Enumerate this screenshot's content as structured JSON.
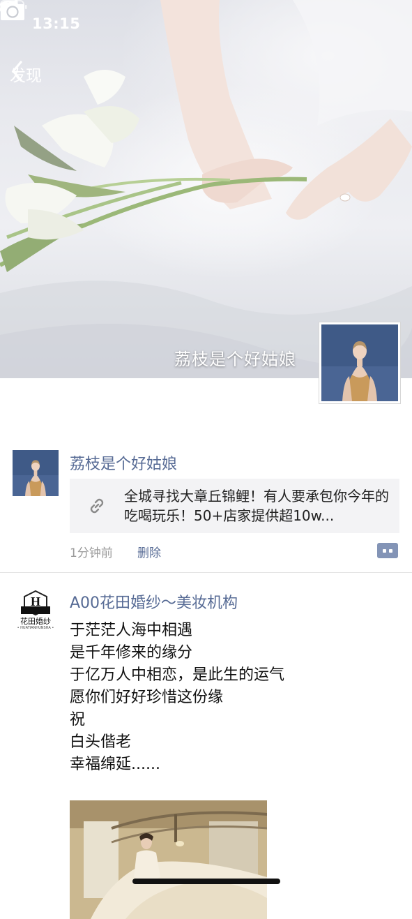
{
  "status_bar": {
    "time": "13:15"
  },
  "nav": {
    "back_label": "发现"
  },
  "cover": {
    "username": "荔枝是个好姑娘"
  },
  "posts": [
    {
      "author": "荔枝是个好姑娘",
      "link_title": "全城寻找大章丘锦鲤！有人要承包你今年的吃喝玩乐！50+店家提供超10w...",
      "time": "1分钟前",
      "delete_label": "删除"
    },
    {
      "author": "A00花田婚纱～美妆机构",
      "logo_text": "花田婚纱",
      "logo_subtext": "• HUATIANHUNSHA •",
      "logo_letter": "H",
      "text": "于茫茫人海中相遇\n是千年修来的缘分\n于亿万人中相恋，是此生的运气\n愿你们好好珍惜这份缘\n祝\n白头偕老\n幸福绵延......"
    }
  ],
  "colors": {
    "link_blue": "#576b95",
    "meta_gray": "#9a9a9a",
    "card_bg": "#f3f3f5",
    "comment_button": "#8394b6"
  },
  "icons": [
    "signal-icon",
    "wifi-icon",
    "battery-icon",
    "back-chevron-icon",
    "camera-icon",
    "link-icon",
    "comment-icon"
  ]
}
